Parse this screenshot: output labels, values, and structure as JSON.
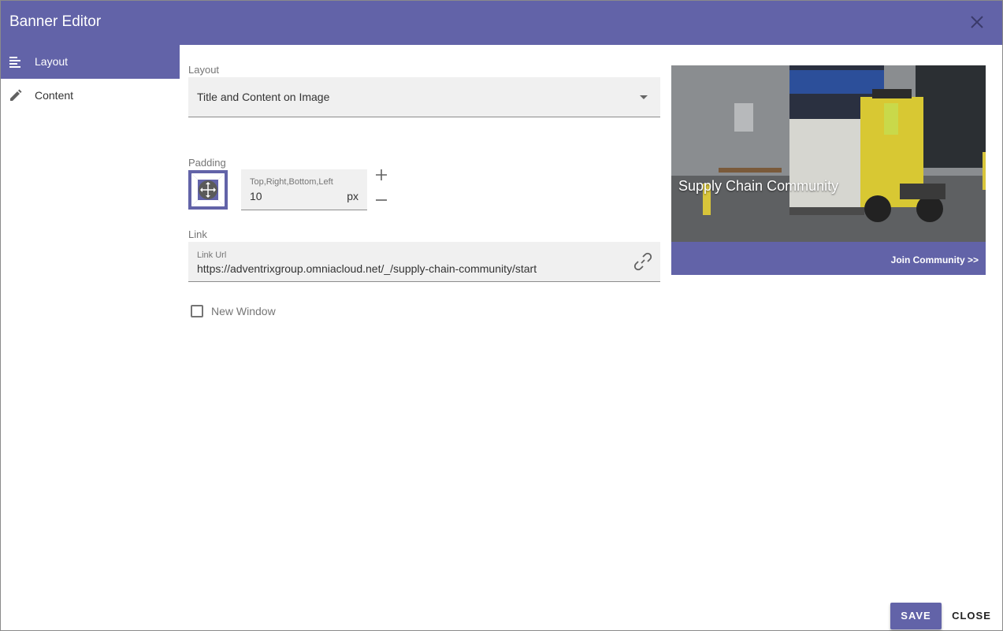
{
  "header": {
    "title": "Banner Editor",
    "close_icon": "close-icon"
  },
  "sidebar": {
    "items": [
      {
        "label": "Layout",
        "icon": "align-left-icon",
        "active": true
      },
      {
        "label": "Content",
        "icon": "pencil-icon",
        "active": false
      }
    ]
  },
  "layout_section": {
    "label": "Layout",
    "selected": "Title and Content on Image"
  },
  "padding": {
    "label": "Padding",
    "field_label": "Top,Right,Bottom,Left",
    "value": "10",
    "unit": "px"
  },
  "link": {
    "label": "Link",
    "field_label": "Link Url",
    "value": "https://adventrixgroup.omniacloud.net/_/supply-chain-community/start"
  },
  "new_window": {
    "label": "New Window",
    "checked": false
  },
  "preview": {
    "title": "Supply Chain Community",
    "cta": "Join Community >>"
  },
  "footer": {
    "save_label": "SAVE",
    "close_label": "CLOSE"
  },
  "colors": {
    "accent": "#6263a8",
    "field_bg": "#f0f0f0"
  }
}
